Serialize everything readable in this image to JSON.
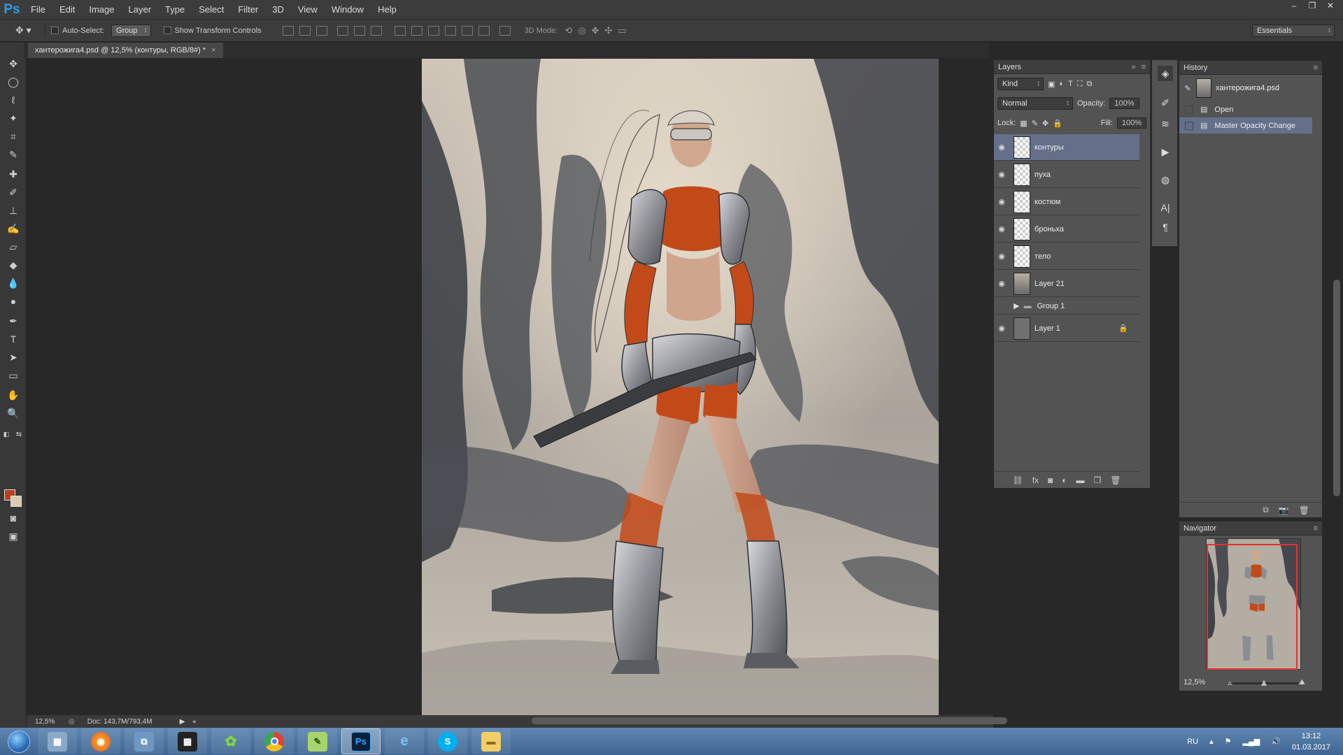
{
  "app": {
    "logo": "Ps"
  },
  "menu": [
    "File",
    "Edit",
    "Image",
    "Layer",
    "Type",
    "Select",
    "Filter",
    "3D",
    "View",
    "Window",
    "Help"
  ],
  "window_controls": {
    "minimize": "–",
    "restore": "❐",
    "close": "✕"
  },
  "options": {
    "auto_select_label": "Auto-Select:",
    "auto_select_value": "Group",
    "show_transform_label": "Show Transform Controls",
    "mode_3d_label": "3D Mode:",
    "workspace": "Essentials"
  },
  "document": {
    "tab_title": "хантерожига4.psd @ 12,5% (контуры, RGB/8#) *",
    "tab_close": "×",
    "zoom": "12,5%",
    "doc_size": "Doc: 143,7M/793,4M"
  },
  "layers_panel": {
    "title": "Layers",
    "filter_kind": "Kind",
    "blend_mode": "Normal",
    "opacity_label": "Opacity:",
    "opacity_value": "100%",
    "lock_label": "Lock:",
    "fill_label": "Fill:",
    "fill_value": "100%",
    "layers": [
      {
        "name": "контуры",
        "visible": true,
        "selected": true
      },
      {
        "name": "пуха",
        "visible": true
      },
      {
        "name": "костюм",
        "visible": true
      },
      {
        "name": "броньха",
        "visible": true
      },
      {
        "name": "тело",
        "visible": true
      },
      {
        "name": "Layer 21",
        "visible": true
      },
      {
        "name": "Group 1",
        "visible": false,
        "group": true
      },
      {
        "name": "Layer 1",
        "visible": true,
        "locked": true
      }
    ],
    "footer_icons": [
      "link-icon",
      "fx-icon",
      "mask-icon",
      "adjustment-icon",
      "folder-icon",
      "new-layer-icon",
      "trash-icon"
    ]
  },
  "history_panel": {
    "title": "History",
    "snapshot": "хантерожига4.psd",
    "states": [
      "Open",
      "Master Opacity Change"
    ],
    "active_state": "Master Opacity Change"
  },
  "navigator_panel": {
    "title": "Navigator",
    "zoom": "12,5%"
  },
  "taskbar": {
    "apps": [
      "calculator",
      "firefox",
      "network",
      "media",
      "icq",
      "chrome",
      "notepad",
      "photoshop",
      "ie",
      "skype",
      "explorer"
    ],
    "active_app": "photoshop",
    "language": "RU",
    "time": "13:12",
    "date": "01.03.2017"
  },
  "colors": {
    "foreground": "#b5421c",
    "background": "#d9ccb3",
    "accent_selection": "#64708a"
  }
}
